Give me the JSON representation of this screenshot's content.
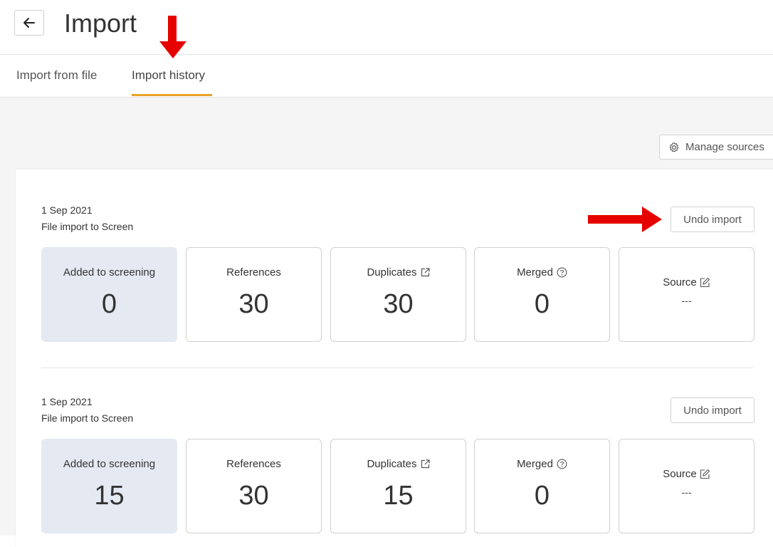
{
  "header": {
    "title": "Import"
  },
  "tabs": [
    {
      "label": "Import from file",
      "active": false
    },
    {
      "label": "Import history",
      "active": true
    }
  ],
  "toolbar": {
    "manage_sources_label": "Manage sources"
  },
  "records": [
    {
      "date": "1 Sep 2021",
      "description": "File import to Screen",
      "undo_label": "Undo import",
      "stats": {
        "added_label": "Added to screening",
        "added_value": "0",
        "references_label": "References",
        "references_value": "30",
        "duplicates_label": "Duplicates",
        "duplicates_value": "30",
        "merged_label": "Merged",
        "merged_value": "0",
        "source_label": "Source",
        "source_value": "---"
      }
    },
    {
      "date": "1 Sep 2021",
      "description": "File import to Screen",
      "undo_label": "Undo import",
      "stats": {
        "added_label": "Added to screening",
        "added_value": "15",
        "references_label": "References",
        "references_value": "30",
        "duplicates_label": "Duplicates",
        "duplicates_value": "15",
        "merged_label": "Merged",
        "merged_value": "0",
        "source_label": "Source",
        "source_value": "---"
      }
    }
  ],
  "colors": {
    "accent_underline": "#e6a32a",
    "annotation_arrow": "#e60000",
    "highlight_card": "#e4e9f2"
  },
  "icons": [
    "back-arrow-icon",
    "gear-icon",
    "external-link-icon",
    "help-circle-icon",
    "edit-icon"
  ]
}
